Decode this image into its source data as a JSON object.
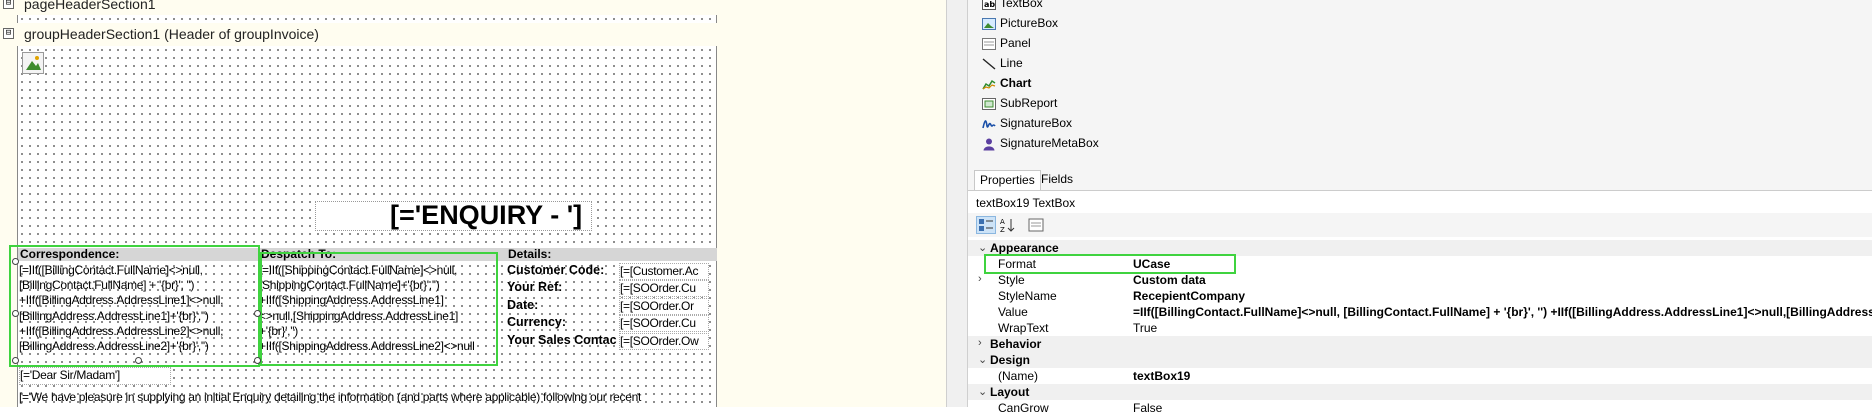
{
  "designer": {
    "bands": {
      "page_header": "pageHeaderSection1",
      "group_header": "groupHeaderSection1 (Header of groupInvoice)"
    },
    "toggle_symbol": "⊟",
    "title_expression": "[='ENQUIRY - ']",
    "correspondence": {
      "header": "Correspondence:",
      "lines": [
        "[=IIf([BillingContact.FullName]<>null,",
        "[BillingContact.FullName] + '{br}', '')",
        "+IIf([BillingAddress.AddressLine1]<>null,",
        "[BillingAddress.AddressLine1]+'{br}','')",
        "+IIf([BillingAddress.AddressLine2]<>null,",
        "[BillingAddress.AddressLine2]+'{br}','')"
      ]
    },
    "despatch": {
      "header": "Despatch To:",
      "lines": [
        "[=IIf([ShippingContact.FullName]<>null,",
        "[ShippingContact.FullName]+'{br}','')",
        "+IIf([ShippingAddress.AddressLine1]",
        "<>null,[ShippingAddress.AddressLine1]",
        "+'{br}','')",
        "+IIf([ShippingAddress.AddressLine2]<>null"
      ]
    },
    "details": {
      "header": "Details:",
      "rows": [
        {
          "label": "Customer Code:",
          "value": "[=[Customer.Ac"
        },
        {
          "label": "Your Ref:",
          "value": "[=[SOOrder.Cu"
        },
        {
          "label": "Date:",
          "value": "[=[SOOrder.Or"
        },
        {
          "label": "Currency:",
          "value": "[=[SOOrder.Cu"
        },
        {
          "label": "Your Sales Contac",
          "value": "[=[SOOrder.Ow"
        }
      ]
    },
    "greeting": "[='Dear Sir/Madam']",
    "intro": "[='We have pleasure in supplying an initial Enquiry detailing the information (and parts where applicable) following our recent"
  },
  "toolbox": {
    "items": [
      {
        "label": "TextBox",
        "icon": "textbox-icon"
      },
      {
        "label": "PictureBox",
        "icon": "picturebox-icon"
      },
      {
        "label": "Panel",
        "icon": "panel-icon"
      },
      {
        "label": "Line",
        "icon": "line-icon"
      },
      {
        "label": "Chart",
        "icon": "chart-icon"
      },
      {
        "label": "SubReport",
        "icon": "subreport-icon"
      },
      {
        "label": "SignatureBox",
        "icon": "signaturebox-icon"
      },
      {
        "label": "SignatureMetaBox",
        "icon": "signaturemetabox-icon"
      }
    ]
  },
  "properties": {
    "tabs": {
      "properties": "Properties",
      "fields": "Fields"
    },
    "selected_object": "textBox19  TextBox",
    "categories": {
      "appearance": "Appearance",
      "behavior": "Behavior",
      "design": "Design",
      "layout": "Layout"
    },
    "appearance_rows": [
      {
        "name": "Format",
        "value": "UCase"
      },
      {
        "name": "Style",
        "value": "Custom data"
      },
      {
        "name": "StyleName",
        "value": "RecepientCompany"
      },
      {
        "name": "Value",
        "value": "=IIf([BillingContact.FullName]<>null,      [BillingContact.FullName] + '{br}', '') +IIf([BillingAddress.AddressLine1]<>null,[BillingAddress"
      },
      {
        "name": "WrapText",
        "value": "True"
      }
    ],
    "design_rows": [
      {
        "name": "(Name)",
        "value": "textBox19"
      }
    ],
    "layout_rows": [
      {
        "name": "CanGrow",
        "value": "False"
      }
    ]
  },
  "colors": {
    "selection": "#3fd33f",
    "designer_bg": "#fffdf0",
    "header_gray": "#d6d6d6"
  }
}
